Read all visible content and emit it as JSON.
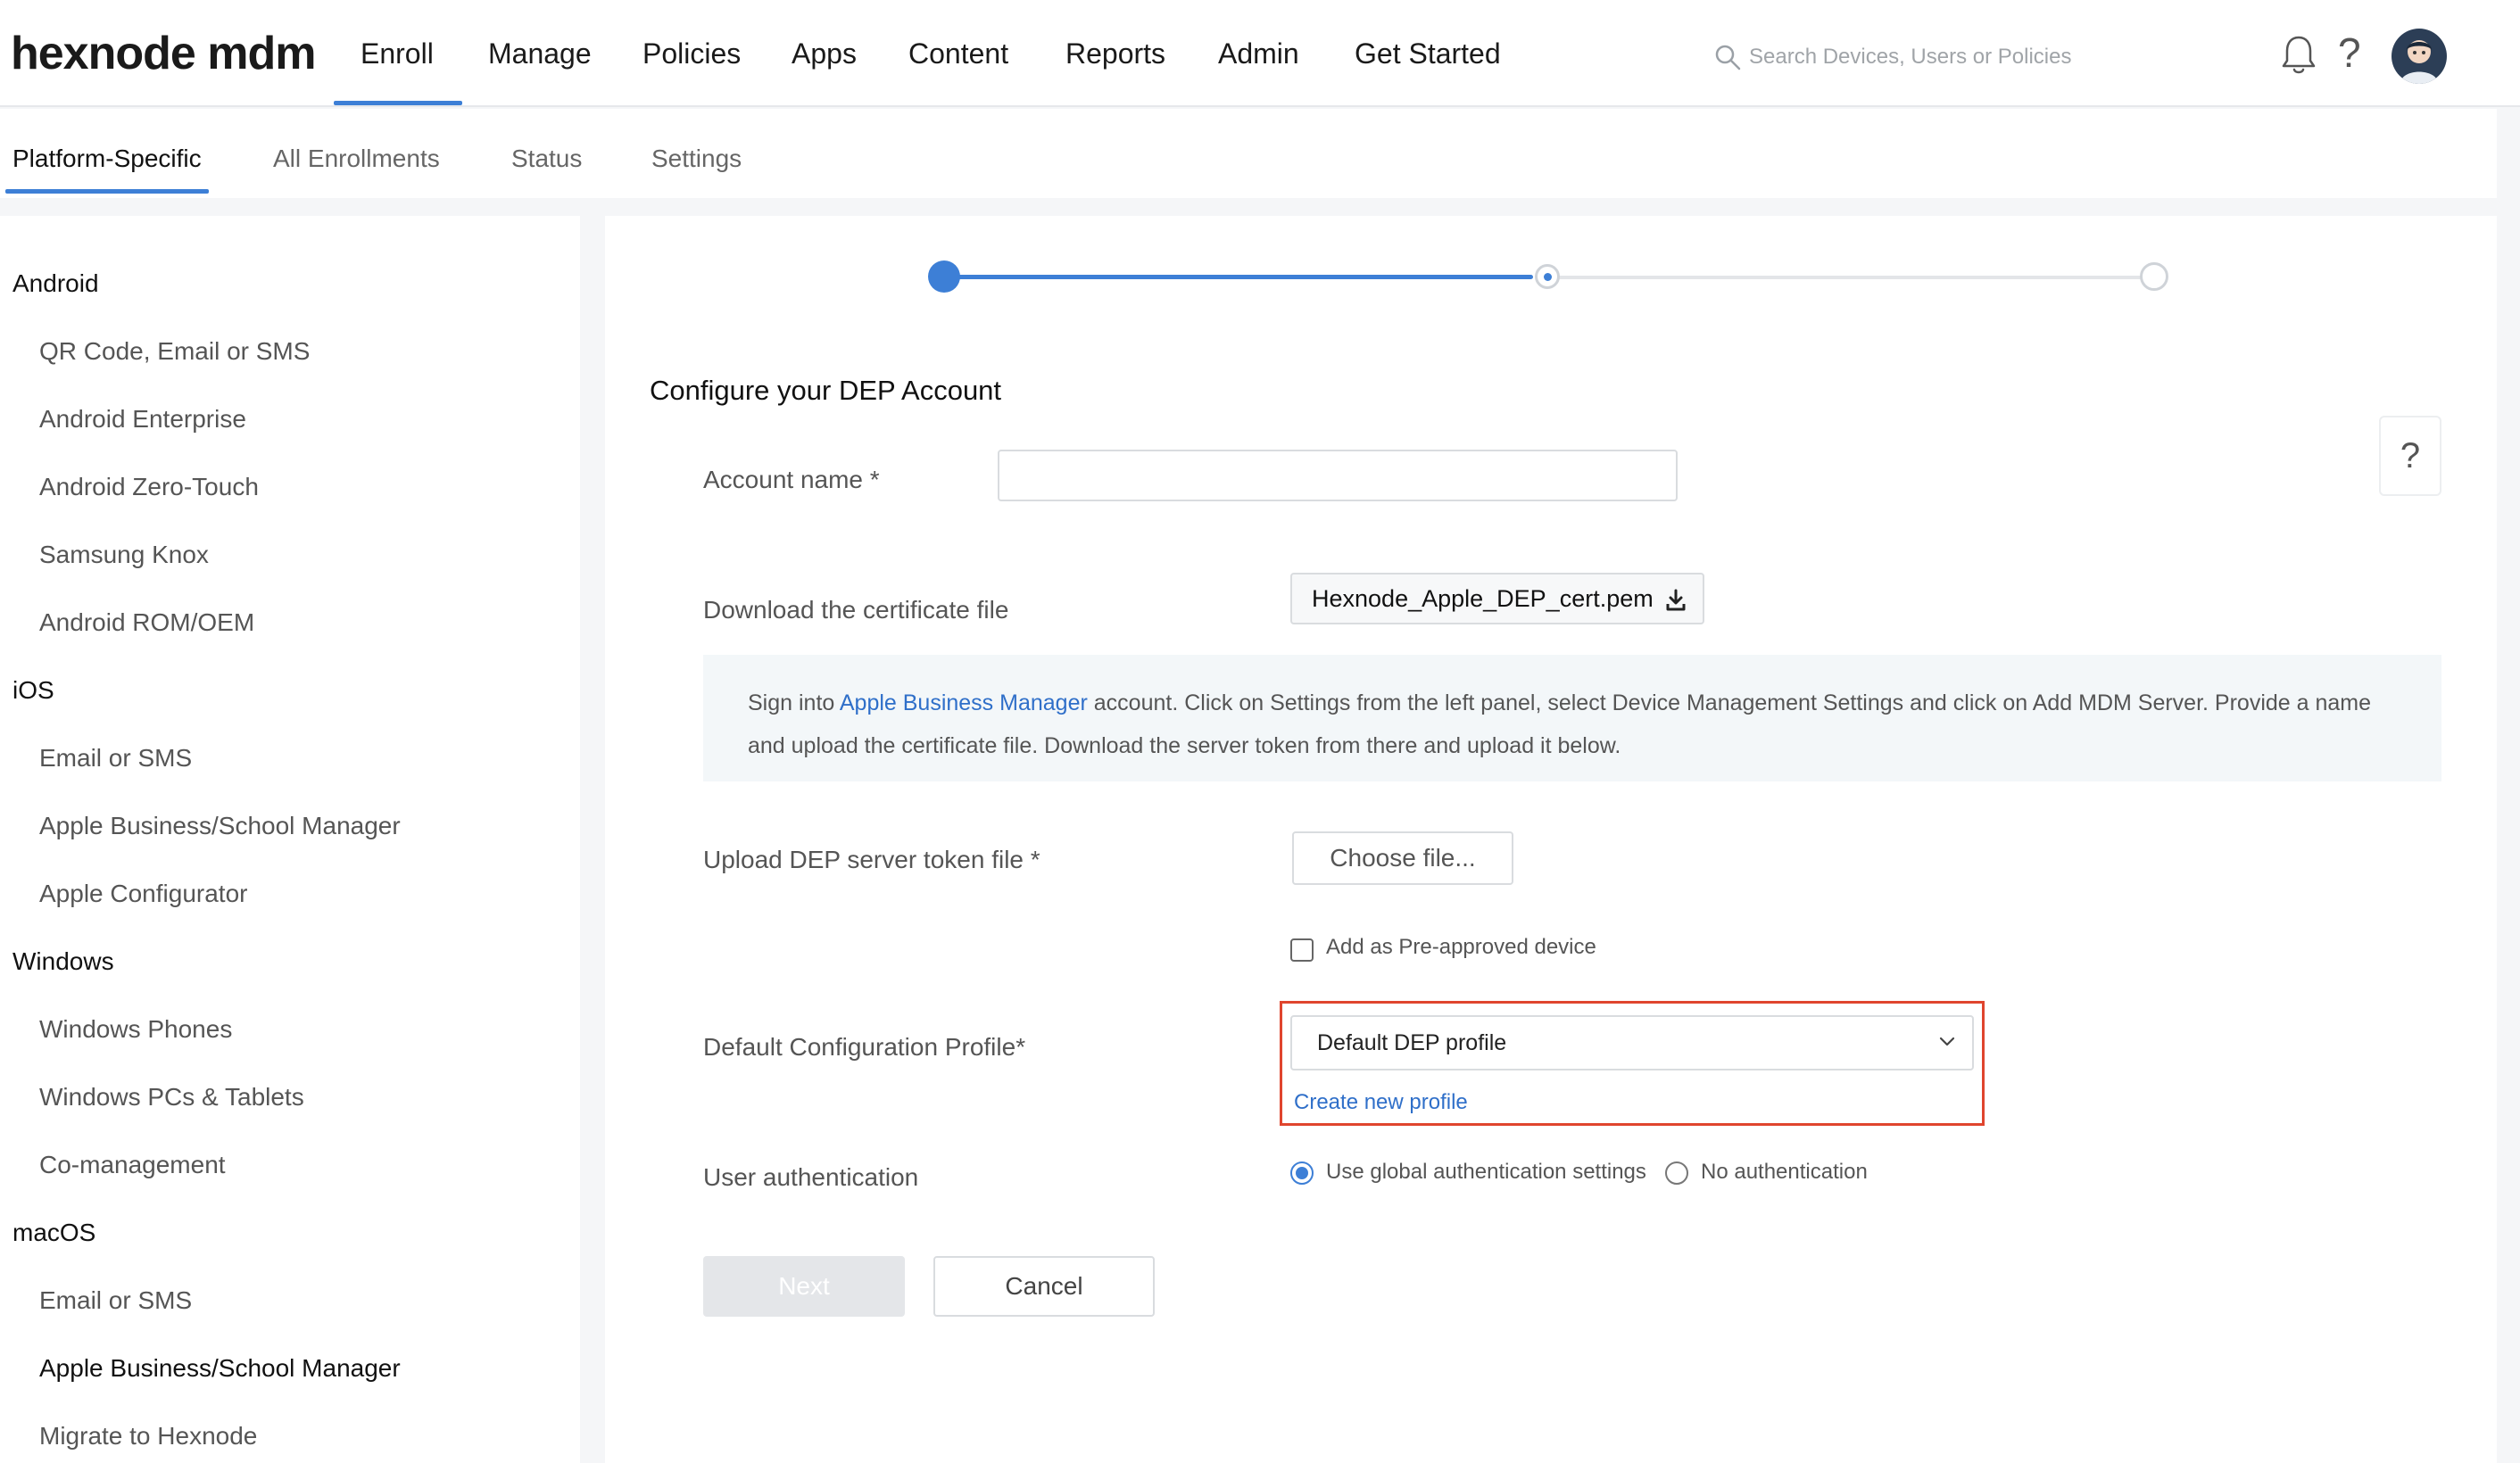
{
  "brand": {
    "logo_text": "hexnode mdm",
    "accent_color": "#3d7fd6",
    "highlight_color": "#e0452e"
  },
  "topnav": {
    "items": [
      {
        "label": "Enroll",
        "active": true
      },
      {
        "label": "Manage"
      },
      {
        "label": "Policies"
      },
      {
        "label": "Apps"
      },
      {
        "label": "Content"
      },
      {
        "label": "Reports"
      },
      {
        "label": "Admin"
      },
      {
        "label": "Get Started"
      }
    ],
    "search_placeholder": "Search Devices, Users or Policies",
    "icons": [
      "search-icon",
      "bell-icon",
      "help-icon",
      "avatar"
    ]
  },
  "subtabs": [
    {
      "label": "Platform-Specific",
      "active": true
    },
    {
      "label": "All Enrollments"
    },
    {
      "label": "Status"
    },
    {
      "label": "Settings"
    }
  ],
  "sidebar": {
    "groups": [
      {
        "title": "Android",
        "items": [
          "QR Code, Email or SMS",
          "Android Enterprise",
          "Android Zero-Touch",
          "Samsung Knox",
          "Android ROM/OEM"
        ]
      },
      {
        "title": "iOS",
        "items": [
          "Email or SMS",
          "Apple Business/School Manager",
          "Apple Configurator"
        ]
      },
      {
        "title": "Windows",
        "items": [
          "Windows Phones",
          "Windows PCs & Tablets",
          "Co-management"
        ]
      },
      {
        "title": "macOS",
        "items": [
          "Email or SMS",
          "Apple Business/School Manager",
          "Migrate to Hexnode"
        ]
      }
    ],
    "active_item": "macOS / Apple Business/School Manager"
  },
  "stepper": {
    "total_steps": 3,
    "current_step": 2
  },
  "form": {
    "title": "Configure your DEP Account",
    "account_name_label": "Account name *",
    "account_name_value": "",
    "download_label": "Download the certificate file",
    "cert_file_name": "Hexnode_Apple_DEP_cert.pem",
    "info": {
      "prefix": "Sign into ",
      "link": "Apple Business Manager",
      "line1_rest": " account. Click on Settings from the left panel, select Device Management Settings and click on Add MDM Server. Provide a name",
      "line2": "and upload the certificate file. Download the server token from there and upload it below."
    },
    "upload_label": "Upload DEP server token file *",
    "choose_file_label": "Choose file...",
    "preapproved_label": "Add as Pre-approved device",
    "preapproved_checked": false,
    "profile_label": "Default Configuration Profile*",
    "profile_selected": "Default DEP profile",
    "create_profile_link": "Create new profile",
    "auth_label": "User authentication",
    "auth_options": [
      {
        "label": "Use global authentication settings",
        "checked": true
      },
      {
        "label": "No authentication",
        "checked": false
      }
    ],
    "next_label": "Next",
    "cancel_label": "Cancel",
    "help_glyph": "?"
  }
}
